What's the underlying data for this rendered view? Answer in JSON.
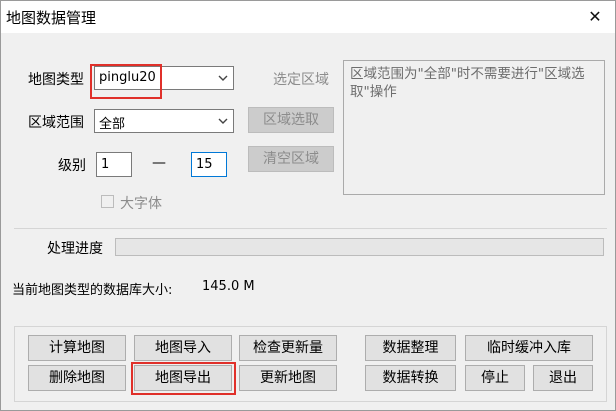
{
  "window": {
    "title": "地图数据管理",
    "close_glyph": "✕"
  },
  "map_type": {
    "label": "地图类型",
    "value": "pinglu20",
    "highlight_color": "#e0302a"
  },
  "select_region_label": "选定区域",
  "region_range": {
    "label": "区域范围",
    "value": "全部"
  },
  "level": {
    "label": "级别",
    "dash": "—",
    "from": "1",
    "to": "15"
  },
  "buttons": {
    "region_select": "区域选取",
    "clear_region": "清空区域",
    "calc_map": "计算地图",
    "import_map": "地图导入",
    "check_update": "检查更新量",
    "data_organize": "数据整理",
    "temp_buffer_import": "临时缓冲入库",
    "delete_map": "删除地图",
    "export_map": "地图导出",
    "update_map": "更新地图",
    "data_convert": "数据转换",
    "stop": "停止",
    "exit": "退出"
  },
  "hint_text": "区域范围为\"全部\"时不需要进行\"区域选取\"操作",
  "large_font": {
    "label": "大字体",
    "checked": false
  },
  "progress": {
    "label": "处理进度",
    "value": 0
  },
  "db_size": {
    "label": "当前地图类型的数据库大小:",
    "value": "145.0 M"
  },
  "icons": {
    "dropdown": "chevron-down-icon",
    "close": "close-icon",
    "checkbox": "checkbox-icon"
  },
  "colors": {
    "accent": "#0078d7",
    "highlight": "#e0302a",
    "disabled_text": "#8c8c8c"
  }
}
